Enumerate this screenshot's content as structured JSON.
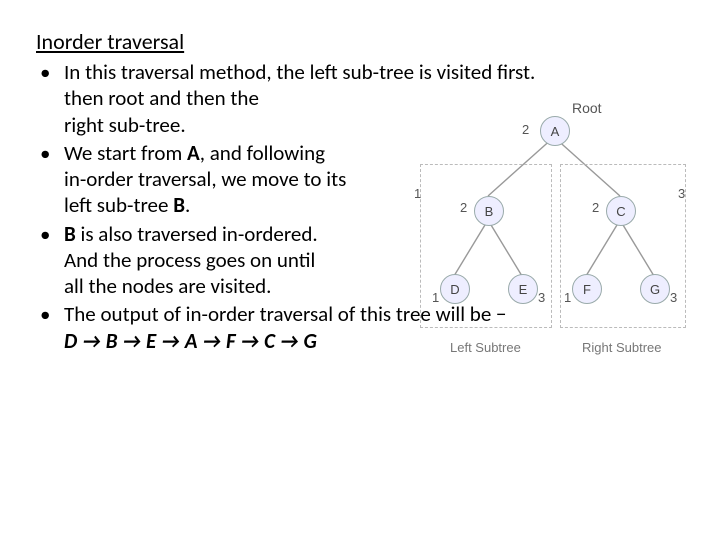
{
  "title": "Inorder  traversal",
  "bullets": [
    {
      "lead": "In this traversal method, the left sub-tree is visited first.",
      "cont": [
        "then root and then the",
        "right sub-tree."
      ]
    },
    {
      "lead_parts": [
        "We start from ",
        "A",
        ", and following"
      ],
      "cont": [
        "in-order traversal, we move to its"
      ],
      "cont2_parts": [
        "left sub-tree ",
        "B",
        "."
      ]
    },
    {
      "lead_parts": [
        "B",
        " is also traversed in-ordered."
      ],
      "cont": [
        "And the process goes on until",
        "all the nodes are visited."
      ]
    }
  ],
  "output_line1": "The output of in-order traversal of this tree will be −",
  "output_sequence": "D → B → E → A → F → C → G",
  "tree": {
    "root_label": "Root",
    "nodes": {
      "A": "A",
      "B": "B",
      "C": "C",
      "D": "D",
      "E": "E",
      "F": "F",
      "G": "G"
    },
    "order_root": [
      "1",
      "2",
      "3"
    ],
    "order_B": [
      "1",
      "2",
      "3"
    ],
    "order_C": [
      "1",
      "2",
      "3"
    ],
    "left_caption": "Left Subtree",
    "right_caption": "Right Subtree"
  }
}
